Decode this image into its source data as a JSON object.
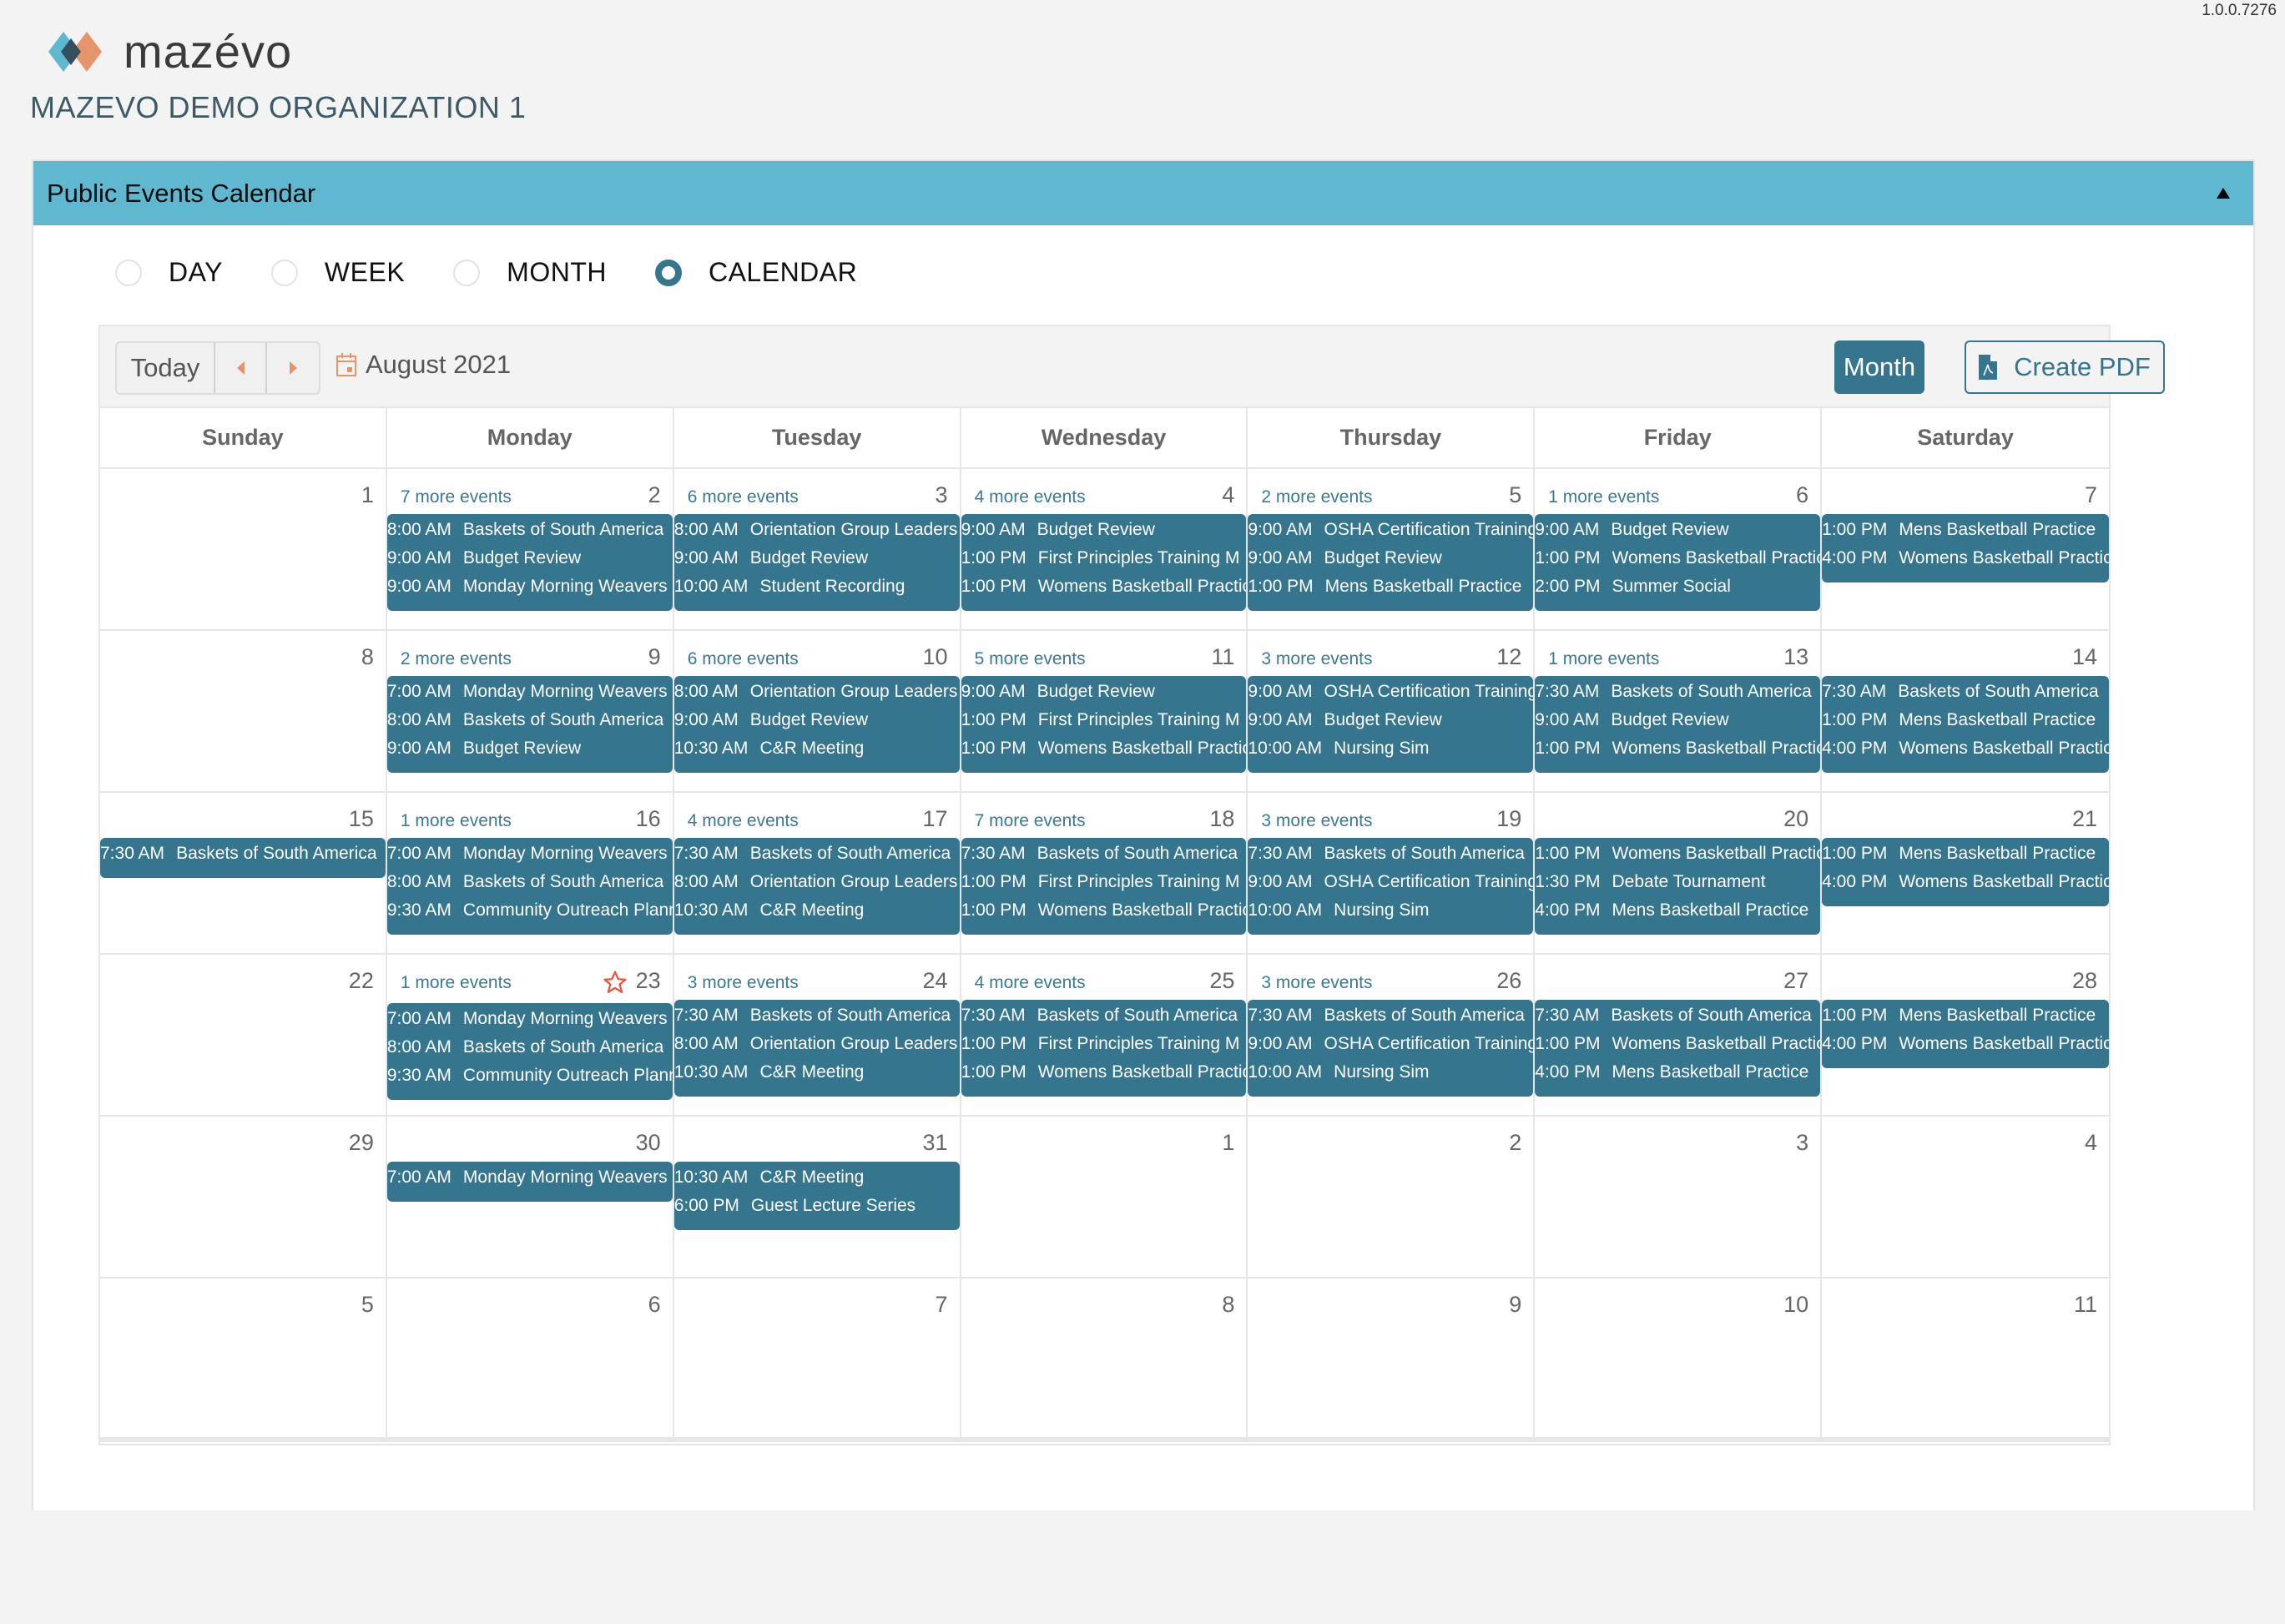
{
  "version": "1.0.0.7276",
  "brand": {
    "name": "mazévo",
    "colors": {
      "blue": "#5fb8d0",
      "orange": "#e8946b",
      "dark": "#34505e"
    }
  },
  "organization": "MAZEVO DEMO ORGANIZATION 1",
  "panel": {
    "title": "Public Events Calendar",
    "collapse_icon": "triangle-up-icon"
  },
  "view_options": [
    {
      "label": "DAY",
      "checked": false
    },
    {
      "label": "WEEK",
      "checked": false
    },
    {
      "label": "MONTH",
      "checked": false
    },
    {
      "label": "CALENDAR",
      "checked": true
    }
  ],
  "toolbar": {
    "today_label": "Today",
    "prev_icon": "triangle-left-icon",
    "next_icon": "triangle-right-icon",
    "period_label": "August 2021",
    "month_label": "Month",
    "pdf_label": "Create PDF"
  },
  "colors": {
    "accent": "#35758d",
    "header_bar": "#5fb8d0",
    "nav_arrow": "#e8946b",
    "star": "#e8553f"
  },
  "weekdays": [
    "Sunday",
    "Monday",
    "Tuesday",
    "Wednesday",
    "Thursday",
    "Friday",
    "Saturday"
  ],
  "weeks": [
    [
      {
        "day": "1",
        "more": "",
        "events": []
      },
      {
        "day": "2",
        "more": "7 more events",
        "events": [
          {
            "time": "8:00 AM",
            "title": "Baskets of South America"
          },
          {
            "time": "9:00 AM",
            "title": "Budget Review"
          },
          {
            "time": "9:00 AM",
            "title": "Monday Morning Weavers"
          }
        ]
      },
      {
        "day": "3",
        "more": "6 more events",
        "events": [
          {
            "time": "8:00 AM",
            "title": "Orientation Group Leaders"
          },
          {
            "time": "9:00 AM",
            "title": "Budget Review"
          },
          {
            "time": "10:00 AM",
            "title": "Student Recording"
          }
        ]
      },
      {
        "day": "4",
        "more": "4 more events",
        "events": [
          {
            "time": "9:00 AM",
            "title": "Budget Review"
          },
          {
            "time": "1:00 PM",
            "title": "First Principles Training M"
          },
          {
            "time": "1:00 PM",
            "title": "Womens Basketball Practice"
          }
        ]
      },
      {
        "day": "5",
        "more": "2 more events",
        "events": [
          {
            "time": "9:00 AM",
            "title": "OSHA Certification Training"
          },
          {
            "time": "9:00 AM",
            "title": "Budget Review"
          },
          {
            "time": "1:00 PM",
            "title": "Mens Basketball Practice"
          }
        ]
      },
      {
        "day": "6",
        "more": "1 more events",
        "events": [
          {
            "time": "9:00 AM",
            "title": "Budget Review"
          },
          {
            "time": "1:00 PM",
            "title": "Womens Basketball Practice"
          },
          {
            "time": "2:00 PM",
            "title": "Summer Social"
          }
        ]
      },
      {
        "day": "7",
        "more": "",
        "events": [
          {
            "time": "1:00 PM",
            "title": "Mens Basketball Practice"
          },
          {
            "time": "4:00 PM",
            "title": "Womens Basketball Practice"
          }
        ]
      }
    ],
    [
      {
        "day": "8",
        "more": "",
        "events": []
      },
      {
        "day": "9",
        "more": "2 more events",
        "events": [
          {
            "time": "7:00 AM",
            "title": "Monday Morning Weavers"
          },
          {
            "time": "8:00 AM",
            "title": "Baskets of South America"
          },
          {
            "time": "9:00 AM",
            "title": "Budget Review"
          }
        ]
      },
      {
        "day": "10",
        "more": "6 more events",
        "events": [
          {
            "time": "8:00 AM",
            "title": "Orientation Group Leaders"
          },
          {
            "time": "9:00 AM",
            "title": "Budget Review"
          },
          {
            "time": "10:30 AM",
            "title": "C&R Meeting"
          }
        ]
      },
      {
        "day": "11",
        "more": "5 more events",
        "events": [
          {
            "time": "9:00 AM",
            "title": "Budget Review"
          },
          {
            "time": "1:00 PM",
            "title": "First Principles Training M"
          },
          {
            "time": "1:00 PM",
            "title": "Womens Basketball Practice"
          }
        ]
      },
      {
        "day": "12",
        "more": "3 more events",
        "events": [
          {
            "time": "9:00 AM",
            "title": "OSHA Certification Training"
          },
          {
            "time": "9:00 AM",
            "title": "Budget Review"
          },
          {
            "time": "10:00 AM",
            "title": "Nursing Sim"
          }
        ]
      },
      {
        "day": "13",
        "more": "1 more events",
        "events": [
          {
            "time": "7:30 AM",
            "title": "Baskets of South America"
          },
          {
            "time": "9:00 AM",
            "title": "Budget Review"
          },
          {
            "time": "1:00 PM",
            "title": "Womens Basketball Practice"
          }
        ]
      },
      {
        "day": "14",
        "more": "",
        "events": [
          {
            "time": "7:30 AM",
            "title": "Baskets of South America"
          },
          {
            "time": "1:00 PM",
            "title": "Mens Basketball Practice"
          },
          {
            "time": "4:00 PM",
            "title": "Womens Basketball Practice"
          }
        ]
      }
    ],
    [
      {
        "day": "15",
        "more": "",
        "events": [
          {
            "time": "7:30 AM",
            "title": "Baskets of South America"
          }
        ]
      },
      {
        "day": "16",
        "more": "1 more events",
        "events": [
          {
            "time": "7:00 AM",
            "title": "Monday Morning Weavers"
          },
          {
            "time": "8:00 AM",
            "title": "Baskets of South America"
          },
          {
            "time": "9:30 AM",
            "title": "Community Outreach Planning"
          }
        ]
      },
      {
        "day": "17",
        "more": "4 more events",
        "events": [
          {
            "time": "7:30 AM",
            "title": "Baskets of South America"
          },
          {
            "time": "8:00 AM",
            "title": "Orientation Group Leaders"
          },
          {
            "time": "10:30 AM",
            "title": "C&R Meeting"
          }
        ]
      },
      {
        "day": "18",
        "more": "7 more events",
        "events": [
          {
            "time": "7:30 AM",
            "title": "Baskets of South America"
          },
          {
            "time": "1:00 PM",
            "title": "First Principles Training M"
          },
          {
            "time": "1:00 PM",
            "title": "Womens Basketball Practice"
          }
        ]
      },
      {
        "day": "19",
        "more": "3 more events",
        "events": [
          {
            "time": "7:30 AM",
            "title": "Baskets of South America"
          },
          {
            "time": "9:00 AM",
            "title": "OSHA Certification Training"
          },
          {
            "time": "10:00 AM",
            "title": "Nursing Sim"
          }
        ]
      },
      {
        "day": "20",
        "more": "",
        "events": [
          {
            "time": "1:00 PM",
            "title": "Womens Basketball Practice"
          },
          {
            "time": "1:30 PM",
            "title": "Debate Tournament"
          },
          {
            "time": "4:00 PM",
            "title": "Mens Basketball Practice"
          }
        ]
      },
      {
        "day": "21",
        "more": "",
        "events": [
          {
            "time": "1:00 PM",
            "title": "Mens Basketball Practice"
          },
          {
            "time": "4:00 PM",
            "title": "Womens Basketball Practice"
          }
        ]
      }
    ],
    [
      {
        "day": "22",
        "more": "",
        "events": []
      },
      {
        "day": "23",
        "more": "1 more events",
        "today": true,
        "star_icon": "star-outline-icon",
        "events": [
          {
            "time": "7:00 AM",
            "title": "Monday Morning Weavers"
          },
          {
            "time": "8:00 AM",
            "title": "Baskets of South America"
          },
          {
            "time": "9:30 AM",
            "title": "Community Outreach Planning"
          }
        ]
      },
      {
        "day": "24",
        "more": "3 more events",
        "events": [
          {
            "time": "7:30 AM",
            "title": "Baskets of South America"
          },
          {
            "time": "8:00 AM",
            "title": "Orientation Group Leaders"
          },
          {
            "time": "10:30 AM",
            "title": "C&R Meeting"
          }
        ]
      },
      {
        "day": "25",
        "more": "4 more events",
        "events": [
          {
            "time": "7:30 AM",
            "title": "Baskets of South America"
          },
          {
            "time": "1:00 PM",
            "title": "First Principles Training M"
          },
          {
            "time": "1:00 PM",
            "title": "Womens Basketball Practice"
          }
        ]
      },
      {
        "day": "26",
        "more": "3 more events",
        "events": [
          {
            "time": "7:30 AM",
            "title": "Baskets of South America"
          },
          {
            "time": "9:00 AM",
            "title": "OSHA Certification Training"
          },
          {
            "time": "10:00 AM",
            "title": "Nursing Sim"
          }
        ]
      },
      {
        "day": "27",
        "more": "",
        "events": [
          {
            "time": "7:30 AM",
            "title": "Baskets of South America"
          },
          {
            "time": "1:00 PM",
            "title": "Womens Basketball Practice"
          },
          {
            "time": "4:00 PM",
            "title": "Mens Basketball Practice"
          }
        ]
      },
      {
        "day": "28",
        "more": "",
        "events": [
          {
            "time": "1:00 PM",
            "title": "Mens Basketball Practice"
          },
          {
            "time": "4:00 PM",
            "title": "Womens Basketball Practice"
          }
        ]
      }
    ],
    [
      {
        "day": "29",
        "more": "",
        "events": []
      },
      {
        "day": "30",
        "more": "",
        "events": [
          {
            "time": "7:00 AM",
            "title": "Monday Morning Weavers"
          }
        ]
      },
      {
        "day": "31",
        "more": "",
        "events": [
          {
            "time": "10:30 AM",
            "title": "C&R Meeting"
          },
          {
            "time": "6:00 PM",
            "title": "Guest Lecture Series"
          }
        ]
      },
      {
        "day": "1",
        "more": "",
        "events": []
      },
      {
        "day": "2",
        "more": "",
        "events": []
      },
      {
        "day": "3",
        "more": "",
        "events": []
      },
      {
        "day": "4",
        "more": "",
        "events": []
      }
    ],
    [
      {
        "day": "5",
        "more": "",
        "events": []
      },
      {
        "day": "6",
        "more": "",
        "events": []
      },
      {
        "day": "7",
        "more": "",
        "events": []
      },
      {
        "day": "8",
        "more": "",
        "events": []
      },
      {
        "day": "9",
        "more": "",
        "events": []
      },
      {
        "day": "10",
        "more": "",
        "events": []
      },
      {
        "day": "11",
        "more": "",
        "events": []
      }
    ]
  ]
}
